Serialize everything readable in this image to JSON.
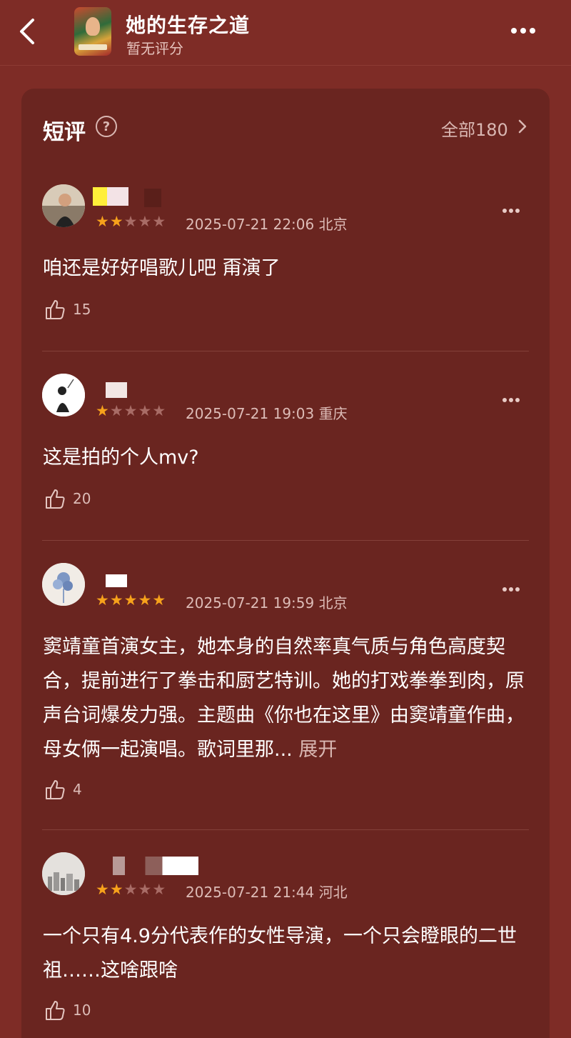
{
  "header": {
    "title": "她的生存之道",
    "subtitle": "暂无评分"
  },
  "section": {
    "title": "短评",
    "all_label": "全部180"
  },
  "reviews": [
    {
      "stars": 2,
      "date": "2025-07-21 22:06",
      "location": "北京",
      "text": "咱还是好好唱歌儿吧 甭演了",
      "likes": "15"
    },
    {
      "stars": 1,
      "date": "2025-07-21 19:03",
      "location": "重庆",
      "text": "这是拍的个人mv?",
      "likes": "20"
    },
    {
      "stars": 5,
      "date": "2025-07-21 19:59",
      "location": "北京",
      "text": "窦靖童首演女主，她本身的自然率真气质与角色高度契合，提前进行了拳击和厨艺特训。她的打戏拳拳到肉，原声台词爆发力强。主题曲《你也在这里》由窦靖童作曲，母女俩一起演唱。歌词里那...",
      "expand_label": "展开",
      "likes": "4"
    },
    {
      "stars": 2,
      "date": "2025-07-21 21:44",
      "location": "河北",
      "text": "一个只有4.9分代表作的女性导演，一个只会瞪眼的二世祖……这啥跟啥",
      "likes": "10"
    }
  ],
  "colors": {
    "background": "#7e2c26",
    "card": "#6a2520",
    "star_active": "#f7a21b",
    "secondary_text": "#ddbcb7"
  }
}
